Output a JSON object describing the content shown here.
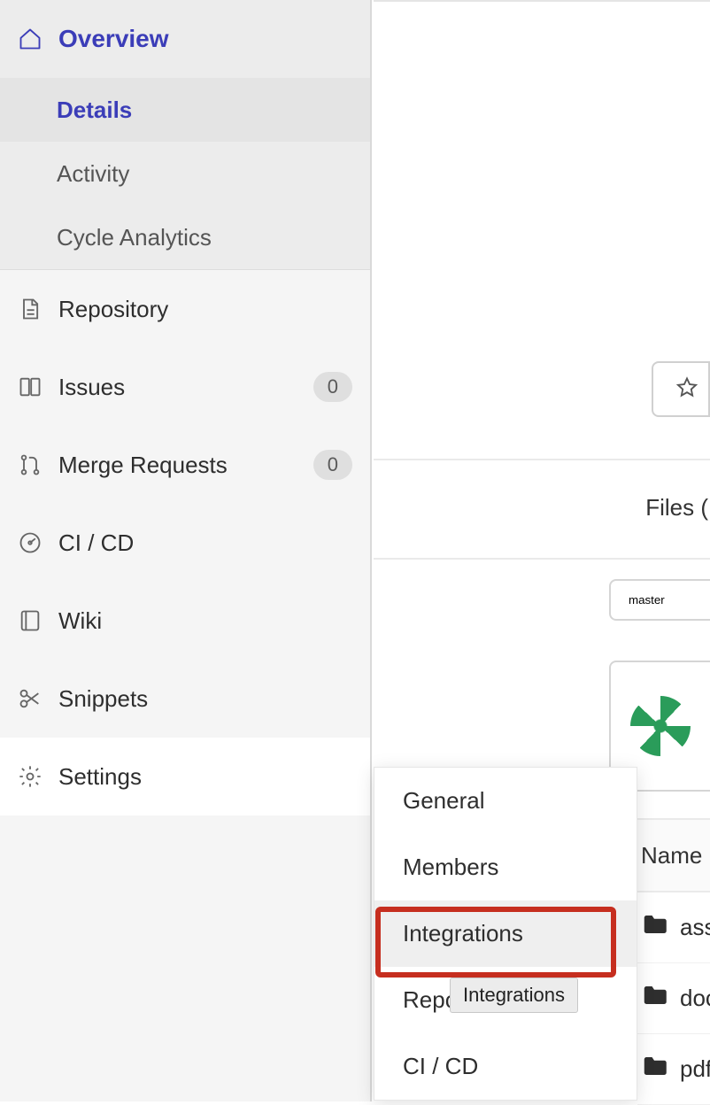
{
  "sidebar": {
    "overview": {
      "label": "Overview",
      "subitems": [
        {
          "label": "Details",
          "active": true
        },
        {
          "label": "Activity"
        },
        {
          "label": "Cycle Analytics"
        }
      ]
    },
    "items": [
      {
        "label": "Repository"
      },
      {
        "label": "Issues",
        "badge": "0"
      },
      {
        "label": "Merge Requests",
        "badge": "0"
      },
      {
        "label": "CI / CD"
      },
      {
        "label": "Wiki"
      },
      {
        "label": "Snippets"
      },
      {
        "label": "Settings"
      }
    ]
  },
  "main": {
    "files_tab": "Files (",
    "branch": "master",
    "name_header": "Name",
    "rows": [
      {
        "name": "ass"
      },
      {
        "name": "doc"
      },
      {
        "name": "pdf"
      }
    ]
  },
  "flyout": {
    "items": [
      {
        "label": "General"
      },
      {
        "label": "Members"
      },
      {
        "label": "Integrations",
        "hovered": true
      },
      {
        "label": "Repository"
      },
      {
        "label": "CI / CD"
      }
    ]
  },
  "tooltip": "Integrations"
}
